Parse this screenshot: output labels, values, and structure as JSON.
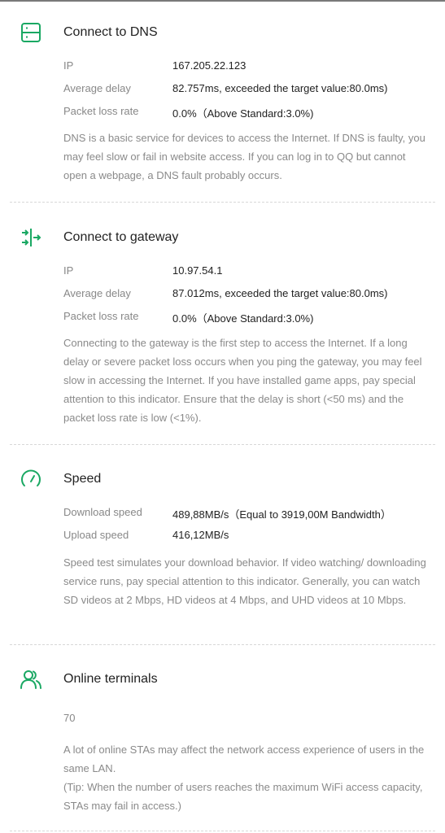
{
  "colors": {
    "accent": "#1aa863"
  },
  "dns": {
    "icon": "server-icon",
    "title": "Connect to DNS",
    "ip_label": "IP",
    "ip_value": "167.205.22.123",
    "delay_label": "Average delay",
    "delay_value": "82.757ms, exceeded the target value:80.0ms)",
    "loss_label": "Packet loss rate",
    "loss_value": "0.0%（Above Standard:3.0%)",
    "description": "DNS is a basic service for devices to access the Internet. If DNS is faulty, you may feel slow or fail in website access. If you can log in to QQ but cannot open a webpage, a DNS fault probably occurs."
  },
  "gateway": {
    "icon": "gateway-icon",
    "title": "Connect to gateway",
    "ip_label": "IP",
    "ip_value": "10.97.54.1",
    "delay_label": "Average delay",
    "delay_value": "87.012ms, exceeded the target value:80.0ms)",
    "loss_label": "Packet loss rate",
    "loss_value": "0.0%（Above Standard:3.0%)",
    "description": "Connecting to the gateway is the first step to access the Internet. If a long delay or severe packet loss occurs when you ping the gateway, you may feel slow in accessing the Internet. If you have installed game apps, pay special attention to this indicator. Ensure that the delay is short (<50 ms) and the packet loss rate is low (<1%)."
  },
  "speed": {
    "icon": "speedometer-icon",
    "title": "Speed",
    "download_label": "Download speed",
    "download_value": "489,88MB/s（Equal to 3919,00M Bandwidth）",
    "upload_label": "Upload speed",
    "upload_value": "416,12MB/s",
    "description": "Speed test simulates your download behavior. If video watching/ downloading service runs, pay special attention to this indicator. Generally, you can watch SD videos at 2 Mbps, HD videos at 4 Mbps, and UHD videos at 10 Mbps."
  },
  "terminals": {
    "icon": "users-icon",
    "title": "Online terminals",
    "count": "70",
    "description_1": "A lot of online STAs may affect the network access experience of users in the same LAN.",
    "description_2": "(Tip: When the number of users reaches the maximum WiFi access capacity, STAs may fail in access.)"
  }
}
